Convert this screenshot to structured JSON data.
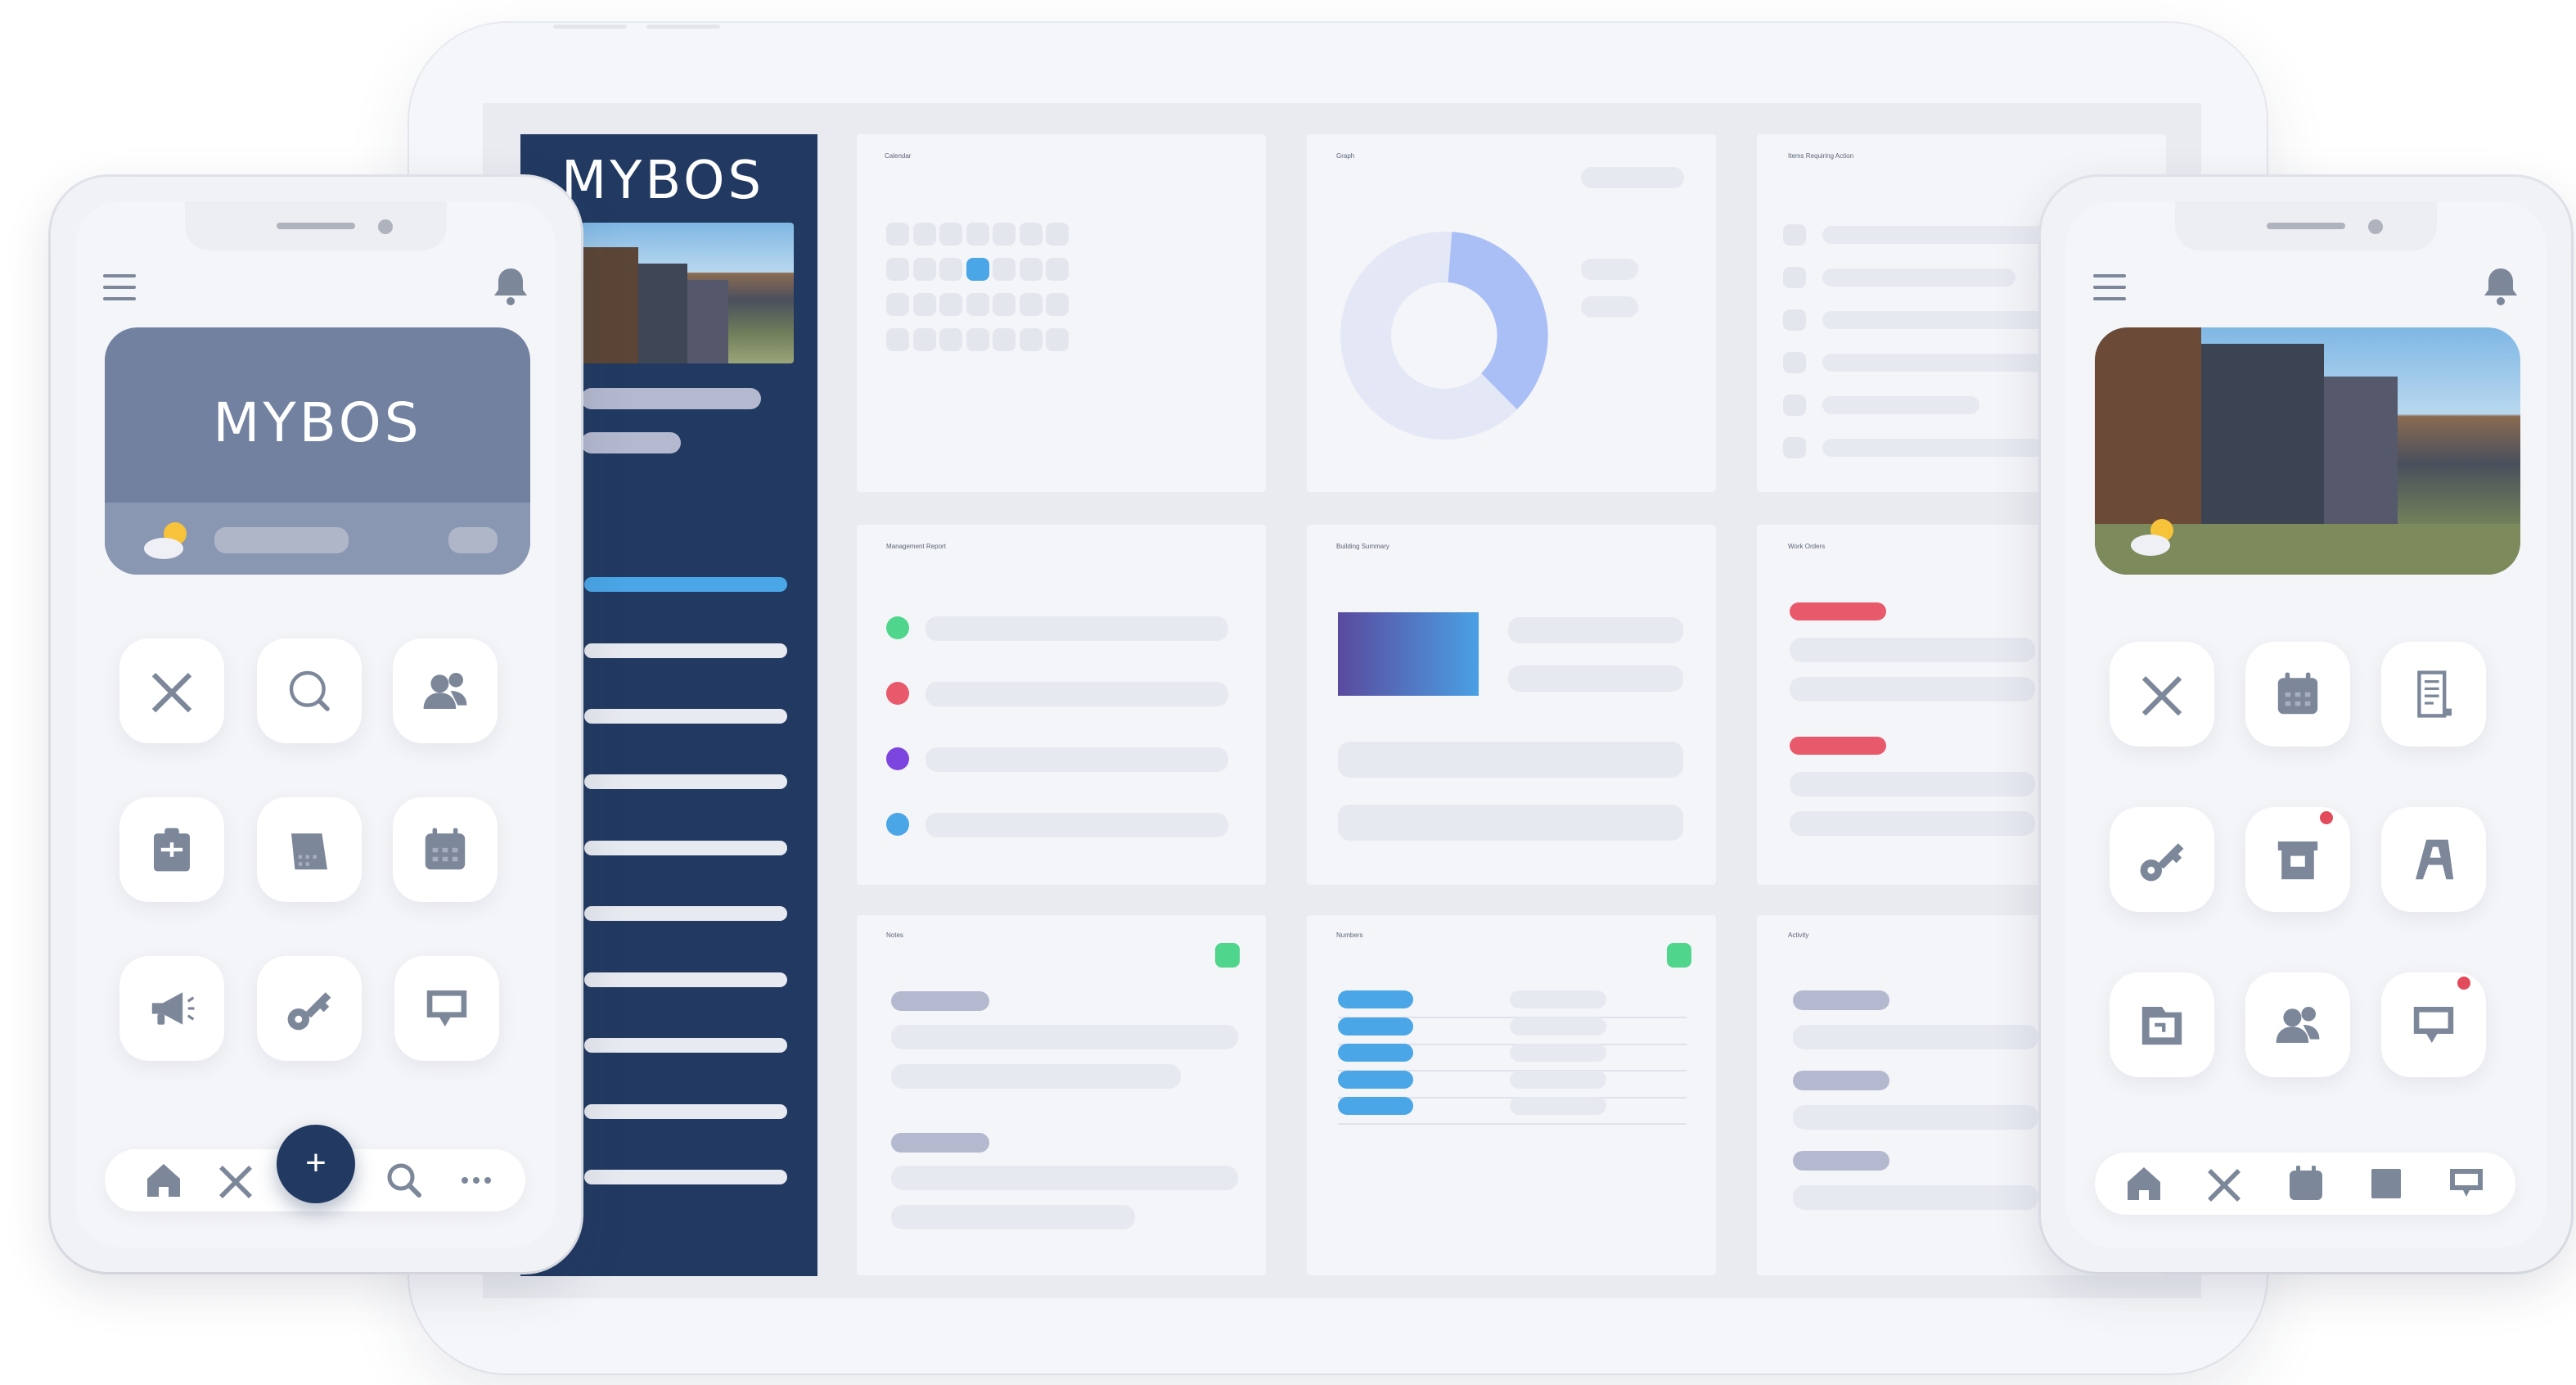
{
  "brand": {
    "name": "MYBOS"
  },
  "colors": {
    "navy": "#223a62",
    "accent_blue": "#4aa6e6",
    "slate": "#7281a0",
    "red": "#e8596b",
    "green": "#4fd68c",
    "purple": "#7d45e0"
  },
  "dashboard": {
    "cards": [
      {
        "title": "Calendar"
      },
      {
        "title": "Graph"
      },
      {
        "title": "Items Requiring Action"
      },
      {
        "title": "Management Report"
      },
      {
        "title": "Building Summary"
      },
      {
        "title": "Work Orders"
      },
      {
        "title": "Notes"
      },
      {
        "title": "Numbers"
      },
      {
        "title": "Activity"
      }
    ]
  },
  "left_phone": {
    "header_icons": [
      "menu-icon",
      "bell-icon"
    ],
    "weather_icon": "partly-cloudy-icon",
    "grid_icons": [
      "tools-icon",
      "search-icon",
      "contacts-icon",
      "clipboard-icon",
      "documents-icon",
      "calendar-icon",
      "megaphone-icon",
      "key-icon",
      "chat-icon"
    ],
    "nav_icons": [
      "home-icon",
      "tools-icon",
      "plus-icon",
      "search-icon",
      "more-icon"
    ],
    "fab_label": "+"
  },
  "right_phone": {
    "header_icons": [
      "menu-icon",
      "bell-icon"
    ],
    "weather_icon": "partly-cloudy-icon",
    "grid_icons": [
      "tools-icon",
      "calendar-icon",
      "document-icon",
      "key-icon",
      "store-icon",
      "easel-icon",
      "folder-icon",
      "contacts-icon",
      "chat-icon"
    ],
    "badges": [
      "store-icon",
      "chat-icon"
    ],
    "nav_icons": [
      "home-icon",
      "tools-icon",
      "calendar-icon",
      "grid-icon",
      "chat-icon"
    ]
  }
}
